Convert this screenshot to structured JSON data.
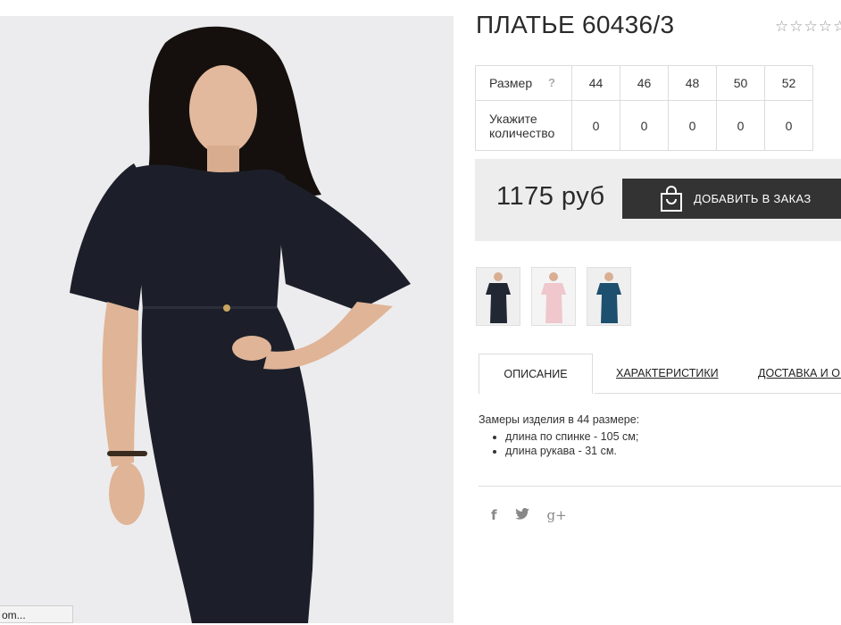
{
  "product": {
    "title": "ПЛАТЬЕ 60436/3",
    "rating_stars": "☆☆☆☆☆"
  },
  "sizes": {
    "size_label": "Размер",
    "help_label": "?",
    "qty_label_1": "Укажите",
    "qty_label_2": "количество",
    "values": [
      "44",
      "46",
      "48",
      "50",
      "52"
    ],
    "quantities": [
      "0",
      "0",
      "0",
      "0",
      "0"
    ]
  },
  "purchase": {
    "price": "1175 руб",
    "button_label": "ДОБАВИТЬ В ЗАКАЗ"
  },
  "thumbnails": [
    {
      "color": "#222833"
    },
    {
      "color": "#efc7cd"
    },
    {
      "color": "#1d4f6e"
    }
  ],
  "tabs": {
    "description": "ОПИСАНИЕ",
    "specs": "ХАРАКТЕРИСТИКИ",
    "delivery": "ДОСТАВКА И ОПЛАТА"
  },
  "description": {
    "intro": "Замеры изделия в 44 размере:",
    "items": [
      "длина по спинке - 105 см;",
      "длина рукава - 31 см."
    ]
  },
  "social": {
    "facebook": "f",
    "twitter": "twitter-icon",
    "google": "g+"
  },
  "status": {
    "text": "om..."
  },
  "colors": {
    "dress": "#1c1f29",
    "button": "#333333",
    "panel": "#ededed"
  }
}
